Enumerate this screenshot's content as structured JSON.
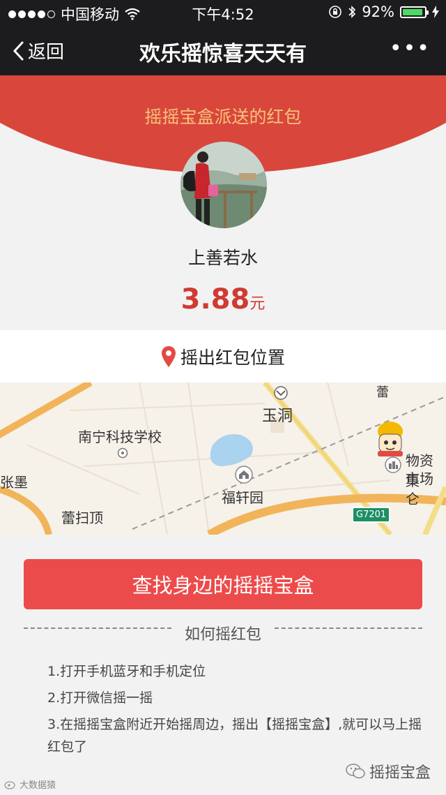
{
  "status_bar": {
    "carrier": "中国移动",
    "time": "下午4:52",
    "battery": "92%",
    "battery_level": 0.92
  },
  "nav": {
    "back_label": "返回",
    "title": "欢乐摇惊喜天天有",
    "more_label": "•••"
  },
  "header": {
    "text": "摇摇宝盒派送的红包"
  },
  "user": {
    "name": "上善若水"
  },
  "amount": {
    "value": "3.88",
    "unit": "元"
  },
  "location": {
    "label": "摇出红包位置"
  },
  "map": {
    "labels": {
      "yudong": "玉洞",
      "school": "南宁科技学校",
      "zhangmo": "张墨",
      "fuxuanyuan": "福轩园",
      "leisaoding": "蕾扫顶",
      "wuzi_line1": "物资集",
      "wuzi_line2": "市场仑",
      "highway": "G7201",
      "lei": "蕾"
    }
  },
  "actions": {
    "find_button": "查找身边的摇摇宝盒"
  },
  "howto": {
    "title": "如何摇红包",
    "steps": [
      "1.打开手机蓝牙和手机定位",
      "2.打开微信摇一摇",
      "3.在摇摇宝盒附近开始摇周边，摇出【摇摇宝盒】,就可以马上摇红包了"
    ]
  },
  "footer": {
    "left": "大数据猿",
    "right": "摇摇宝盒"
  },
  "colors": {
    "header_red": "#d9463c",
    "button_red": "#ec4b4b",
    "amount_red": "#d03a31",
    "header_text": "#f5c37a"
  }
}
